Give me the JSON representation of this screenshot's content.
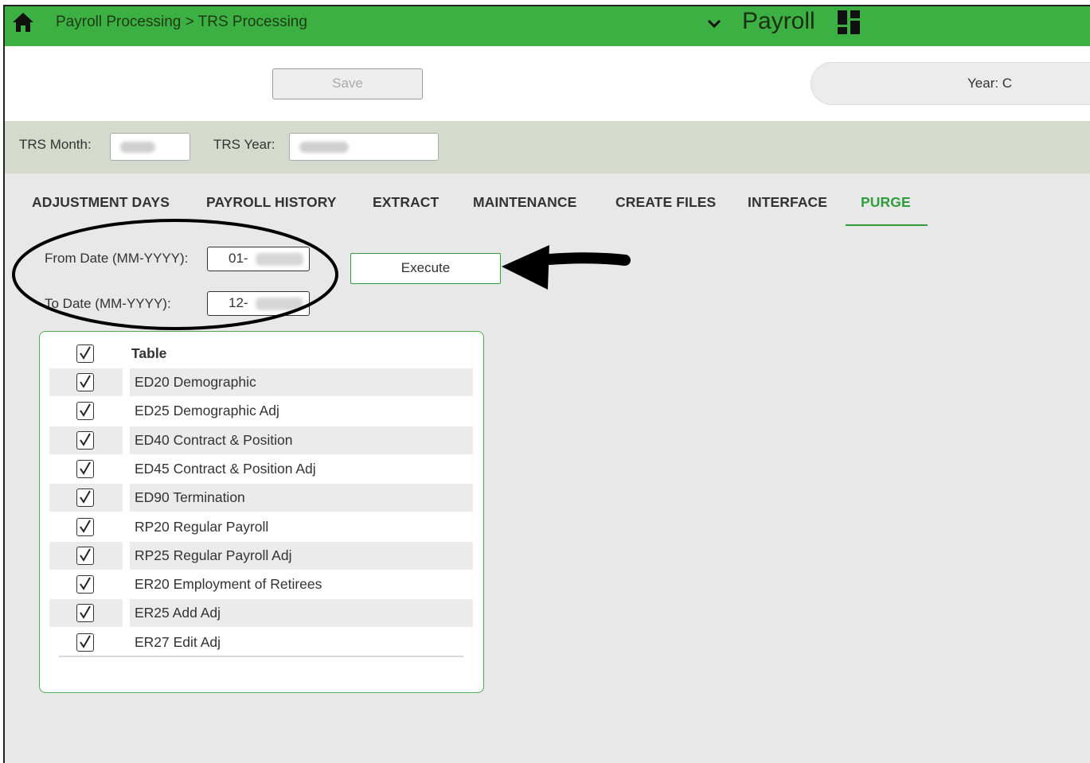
{
  "header": {
    "breadcrumb": "Payroll Processing > TRS Processing",
    "app_title": "Payroll",
    "icons": [
      "home-icon",
      "chevron-down-icon",
      "grid-icon"
    ]
  },
  "toolbar": {
    "save_label": "Save",
    "year_label": "Year: C"
  },
  "trs": {
    "month_label": "TRS Month:",
    "month_value": "",
    "year_label": "TRS Year:",
    "year_value": ""
  },
  "tabs": [
    {
      "label": "ADJUSTMENT DAYS",
      "active": false
    },
    {
      "label": "PAYROLL HISTORY",
      "active": false
    },
    {
      "label": "EXTRACT",
      "active": false
    },
    {
      "label": "MAINTENANCE",
      "active": false
    },
    {
      "label": "CREATE FILES",
      "active": false
    },
    {
      "label": "INTERFACE",
      "active": false
    },
    {
      "label": "PURGE",
      "active": true
    }
  ],
  "purge": {
    "from_label": "From Date (MM-YYYY):",
    "from_value": "01-",
    "to_label": "To Date (MM-YYYY):",
    "to_value": "12-",
    "execute_label": "Execute"
  },
  "table": {
    "header": "Table",
    "header_checked": true,
    "rows": [
      {
        "label": "ED20 Demographic",
        "checked": true
      },
      {
        "label": "ED25 Demographic Adj",
        "checked": true
      },
      {
        "label": "ED40 Contract & Position",
        "checked": true
      },
      {
        "label": "ED45 Contract & Position Adj",
        "checked": true
      },
      {
        "label": "ED90 Termination",
        "checked": true
      },
      {
        "label": "RP20 Regular Payroll",
        "checked": true
      },
      {
        "label": "RP25 Regular Payroll Adj",
        "checked": true
      },
      {
        "label": "ER20 Employment of Retirees",
        "checked": true
      },
      {
        "label": "ER25 Add Adj",
        "checked": true
      },
      {
        "label": "ER27 Edit Adj",
        "checked": true
      }
    ]
  },
  "colors": {
    "brand_green": "#3cb043",
    "active_tab": "#2f9e3a",
    "filter_bar": "#d4dbcd"
  }
}
